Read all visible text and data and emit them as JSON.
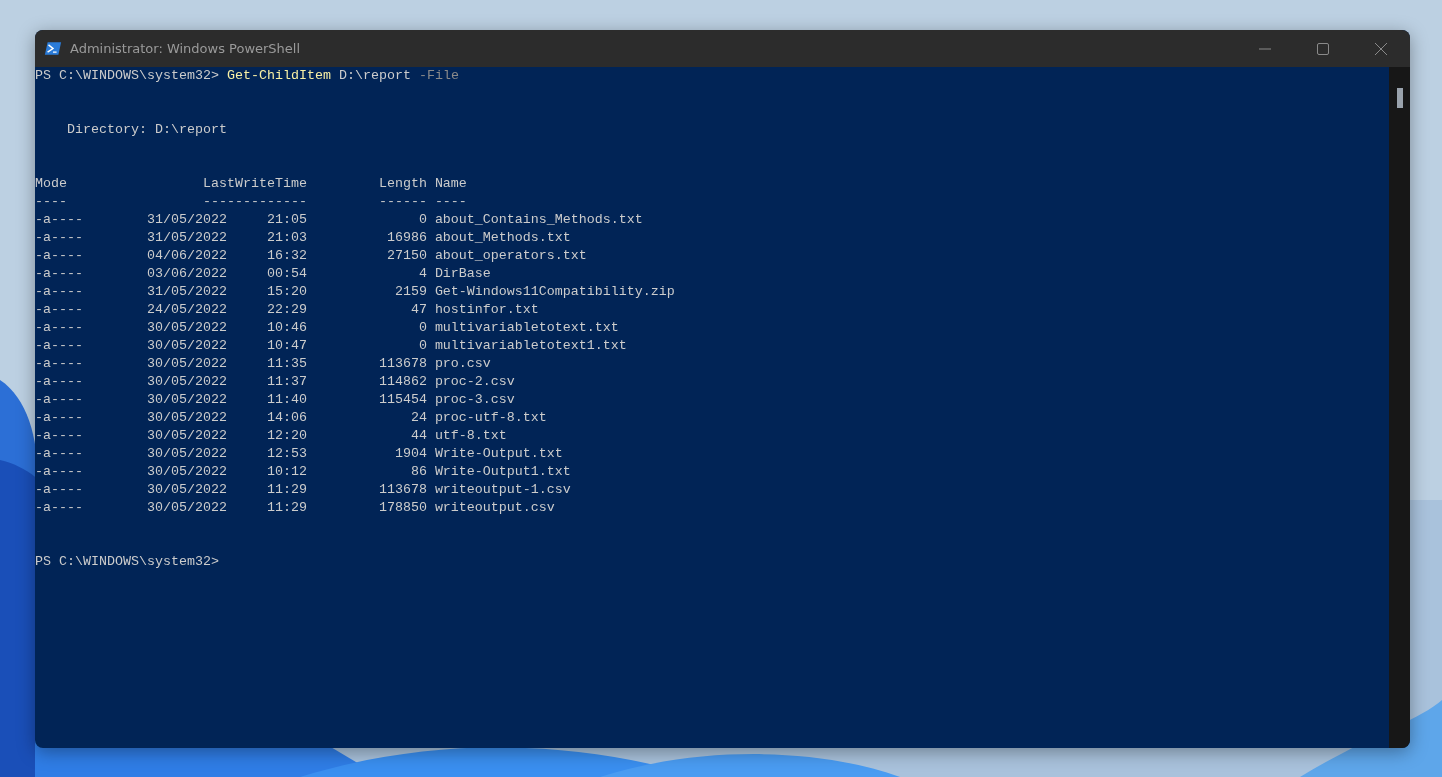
{
  "window": {
    "title": "Administrator: Windows PowerShell"
  },
  "command": {
    "prompt": "PS C:\\WINDOWS\\system32>",
    "cmdlet": "Get-ChildItem",
    "argument": "D:\\report",
    "parameter": "-File"
  },
  "directory": "Directory: D:\\report",
  "table": {
    "columns": [
      "Mode",
      "LastWriteTime",
      "Length",
      "Name"
    ],
    "underlines": [
      "----",
      "-------------",
      "------",
      "----"
    ],
    "rows": [
      {
        "mode": "-a----",
        "date": "31/05/2022",
        "time": "21:05",
        "length": "0",
        "name": "about_Contains_Methods.txt"
      },
      {
        "mode": "-a----",
        "date": "31/05/2022",
        "time": "21:03",
        "length": "16986",
        "name": "about_Methods.txt"
      },
      {
        "mode": "-a----",
        "date": "04/06/2022",
        "time": "16:32",
        "length": "27150",
        "name": "about_operators.txt"
      },
      {
        "mode": "-a----",
        "date": "03/06/2022",
        "time": "00:54",
        "length": "4",
        "name": "DirBase"
      },
      {
        "mode": "-a----",
        "date": "31/05/2022",
        "time": "15:20",
        "length": "2159",
        "name": "Get-Windows11Compatibility.zip"
      },
      {
        "mode": "-a----",
        "date": "24/05/2022",
        "time": "22:29",
        "length": "47",
        "name": "hostinfor.txt"
      },
      {
        "mode": "-a----",
        "date": "30/05/2022",
        "time": "10:46",
        "length": "0",
        "name": "multivariabletotext.txt"
      },
      {
        "mode": "-a----",
        "date": "30/05/2022",
        "time": "10:47",
        "length": "0",
        "name": "multivariabletotext1.txt"
      },
      {
        "mode": "-a----",
        "date": "30/05/2022",
        "time": "11:35",
        "length": "113678",
        "name": "pro.csv"
      },
      {
        "mode": "-a----",
        "date": "30/05/2022",
        "time": "11:37",
        "length": "114862",
        "name": "proc-2.csv"
      },
      {
        "mode": "-a----",
        "date": "30/05/2022",
        "time": "11:40",
        "length": "115454",
        "name": "proc-3.csv"
      },
      {
        "mode": "-a----",
        "date": "30/05/2022",
        "time": "14:06",
        "length": "24",
        "name": "proc-utf-8.txt"
      },
      {
        "mode": "-a----",
        "date": "30/05/2022",
        "time": "12:20",
        "length": "44",
        "name": "utf-8.txt"
      },
      {
        "mode": "-a----",
        "date": "30/05/2022",
        "time": "12:53",
        "length": "1904",
        "name": "Write-Output.txt"
      },
      {
        "mode": "-a----",
        "date": "30/05/2022",
        "time": "10:12",
        "length": "86",
        "name": "Write-Output1.txt"
      },
      {
        "mode": "-a----",
        "date": "30/05/2022",
        "time": "11:29",
        "length": "113678",
        "name": "writeoutput-1.csv"
      },
      {
        "mode": "-a----",
        "date": "30/05/2022",
        "time": "11:29",
        "length": "178850",
        "name": "writeoutput.csv"
      }
    ]
  },
  "final_prompt": "PS C:\\WINDOWS\\system32>"
}
